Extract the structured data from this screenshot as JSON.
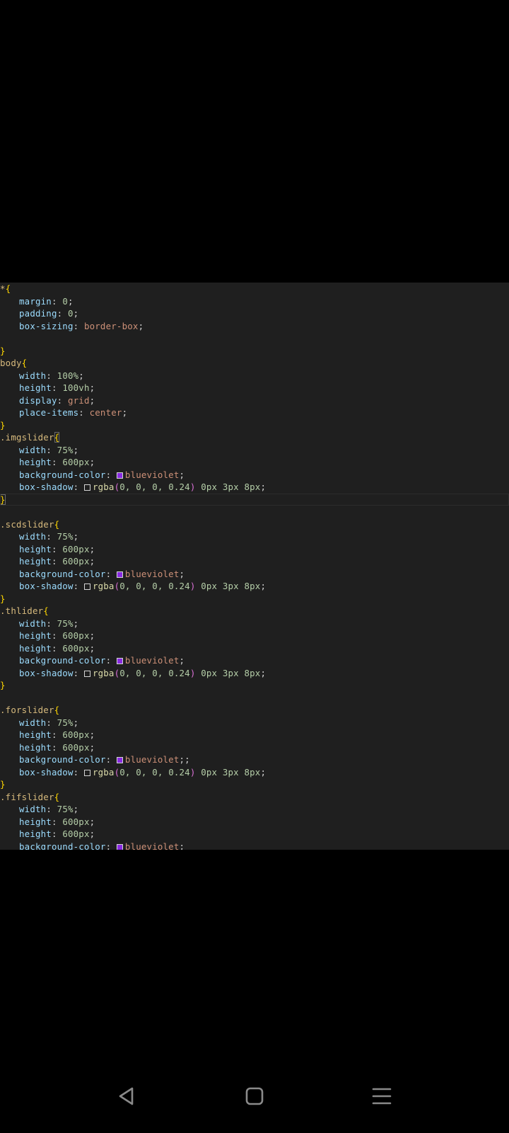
{
  "colors": {
    "editor_bg": "#1f1f1f",
    "selector": "#d7ba7d",
    "brace": "#ffd700",
    "property": "#9cdcfe",
    "number": "#b5cea8",
    "value": "#ce9178",
    "function": "#dcdcaa",
    "paren": "#da70d6",
    "blueviolet_swatch": "#8a2be2",
    "shadow_swatch": "#1f1f1f"
  },
  "code": {
    "lines": [
      [
        "*",
        "{"
      ],
      [
        "margin",
        ":",
        "0",
        ";"
      ],
      [
        "padding",
        ":",
        "0",
        ";"
      ],
      [
        "box-sizing",
        ":",
        "border-box",
        ";"
      ],
      [],
      [
        "}"
      ],
      [
        "body",
        "{"
      ],
      [
        "width",
        ":",
        "100%",
        ";"
      ],
      [
        "height",
        ":",
        "100vh",
        ";"
      ],
      [
        "display",
        ":",
        "grid",
        ";"
      ],
      [
        "place-items",
        ":",
        "center",
        ";"
      ],
      [
        "}"
      ],
      [
        ".imgslider",
        "{"
      ],
      [
        "width",
        ":",
        "75%",
        ";"
      ],
      [
        "height",
        ":",
        "600px",
        ";"
      ],
      [
        "background-color",
        ":",
        "blueviolet",
        ";"
      ],
      [
        "box-shadow",
        ":",
        "rgba",
        "(",
        "0, 0, 0, 0.24",
        ")",
        "0px 3px 8px",
        ";"
      ],
      [
        "}"
      ],
      [],
      [
        ".scdslider",
        "{"
      ],
      [
        "width",
        ":",
        "75%",
        ";"
      ],
      [
        "height",
        ":",
        "600px",
        ";"
      ],
      [
        "height",
        ":",
        "600px",
        ";"
      ],
      [
        "background-color",
        ":",
        "blueviolet",
        ";"
      ],
      [
        "box-shadow",
        ":",
        "rgba",
        "(",
        "0, 0, 0, 0.24",
        ")",
        "0px 3px 8px",
        ";"
      ],
      [
        "}"
      ],
      [
        ".thlider",
        "{"
      ],
      [
        "width",
        ":",
        "75%",
        ";"
      ],
      [
        "height",
        ":",
        "600px",
        ";"
      ],
      [
        "height",
        ":",
        "600px",
        ";"
      ],
      [
        "background-color",
        ":",
        "blueviolet",
        ";"
      ],
      [
        "box-shadow",
        ":",
        "rgba",
        "(",
        "0, 0, 0, 0.24",
        ")",
        "0px 3px 8px",
        ";"
      ],
      [
        "}"
      ],
      [],
      [
        ".forslider",
        "{"
      ],
      [
        "width",
        ":",
        "75%",
        ";"
      ],
      [
        "height",
        ":",
        "600px",
        ";"
      ],
      [
        "height",
        ":",
        "600px",
        ";"
      ],
      [
        "background-color",
        ":",
        "blueviolet",
        ";;"
      ],
      [
        "box-shadow",
        ":",
        "rgba",
        "(",
        "0, 0, 0, 0.24",
        ")",
        "0px 3px 8px",
        ";"
      ],
      [
        "}"
      ],
      [
        ".fifslider",
        "{"
      ],
      [
        "width",
        ":",
        "75%",
        ";"
      ],
      [
        "height",
        ":",
        "600px",
        ";"
      ],
      [
        "height",
        ":",
        "600px",
        ";"
      ],
      [
        "background-color",
        ":",
        "blueviolet",
        ";"
      ]
    ]
  },
  "navbar": {
    "back_icon": "back-triangle-icon",
    "home_icon": "home-square-icon",
    "recents_icon": "menu-lines-icon"
  }
}
